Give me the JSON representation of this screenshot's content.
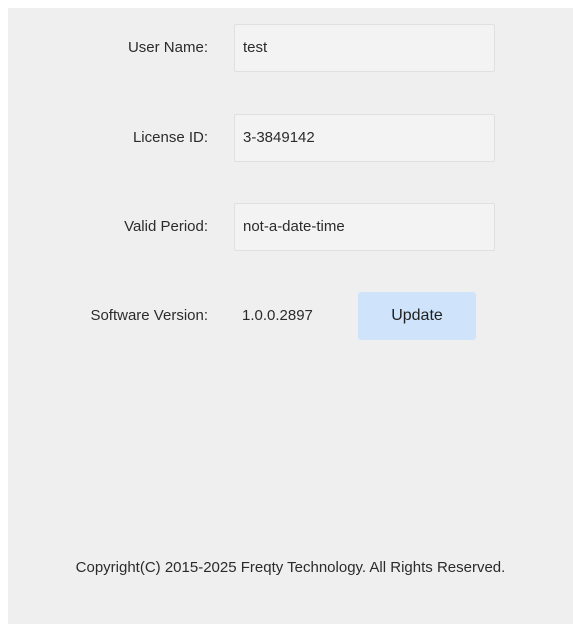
{
  "form": {
    "user_name": {
      "label": "User Name:",
      "value": "test"
    },
    "license_id": {
      "label": "License ID:",
      "value": "3-3849142"
    },
    "valid_period": {
      "label": "Valid Period:",
      "value": "not-a-date-time"
    },
    "software_version": {
      "label": "Software Version:",
      "value": "1.0.0.2897",
      "update_label": "Update"
    }
  },
  "footer": {
    "copyright": "Copyright(C) 2015-2025 Freqty Technology. All Rights Reserved."
  },
  "colors": {
    "update_button_bg": "#cfe3fb",
    "panel_bg": "#efeff0"
  }
}
